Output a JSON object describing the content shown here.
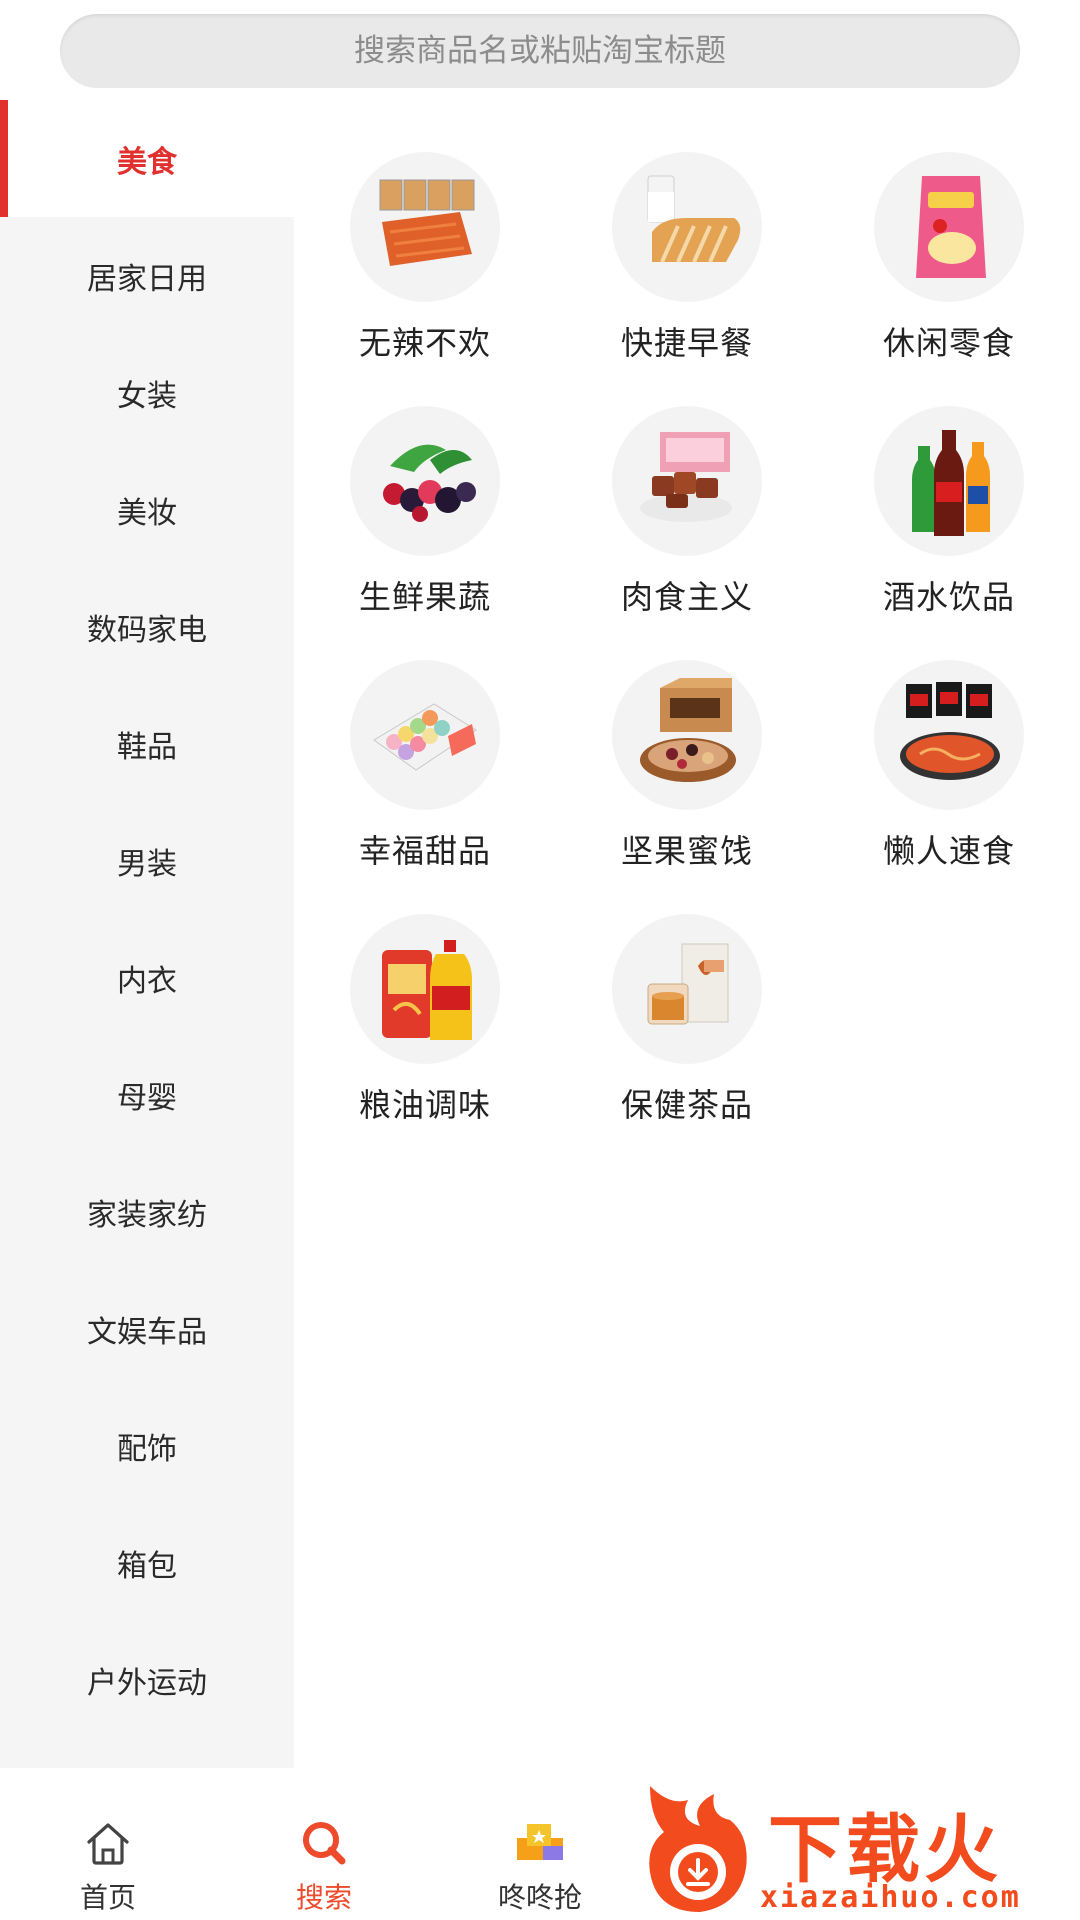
{
  "search": {
    "placeholder": "搜索商品名或粘贴淘宝标题"
  },
  "sidebar": {
    "items": [
      {
        "label": "美食",
        "active": true
      },
      {
        "label": "居家日用"
      },
      {
        "label": "女装"
      },
      {
        "label": "美妆"
      },
      {
        "label": "数码家电"
      },
      {
        "label": "鞋品"
      },
      {
        "label": "男装"
      },
      {
        "label": "内衣"
      },
      {
        "label": "母婴"
      },
      {
        "label": "家装家纺"
      },
      {
        "label": "文娱车品"
      },
      {
        "label": "配饰"
      },
      {
        "label": "箱包"
      },
      {
        "label": "户外运动"
      }
    ]
  },
  "categories": [
    {
      "label": "无辣不欢",
      "icon": "spicy-snack-icon"
    },
    {
      "label": "快捷早餐",
      "icon": "bread-milk-icon"
    },
    {
      "label": "休闲零食",
      "icon": "snack-bag-icon"
    },
    {
      "label": "生鲜果蔬",
      "icon": "berries-icon"
    },
    {
      "label": "肉食主义",
      "icon": "meat-box-icon"
    },
    {
      "label": "酒水饮品",
      "icon": "soda-bottles-icon"
    },
    {
      "label": "幸福甜品",
      "icon": "macarons-icon"
    },
    {
      "label": "坚果蜜饯",
      "icon": "nuts-box-icon"
    },
    {
      "label": "懒人速食",
      "icon": "instant-noodles-icon"
    },
    {
      "label": "粮油调味",
      "icon": "rice-oil-icon"
    },
    {
      "label": "保健茶品",
      "icon": "tea-box-icon"
    }
  ],
  "tabbar": {
    "tabs": [
      {
        "label": "首页",
        "icon": "home-icon"
      },
      {
        "label": "搜索",
        "icon": "search-icon",
        "active": true
      },
      {
        "label": "咚咚抢",
        "icon": "gift-icon"
      }
    ]
  },
  "watermark": {
    "text": "下载火",
    "url": "xiazaihuo.com"
  },
  "colors": {
    "accent": "#e0312f",
    "tab_active": "#ee4a2c",
    "sidebar_bg": "#f5f5f5"
  }
}
